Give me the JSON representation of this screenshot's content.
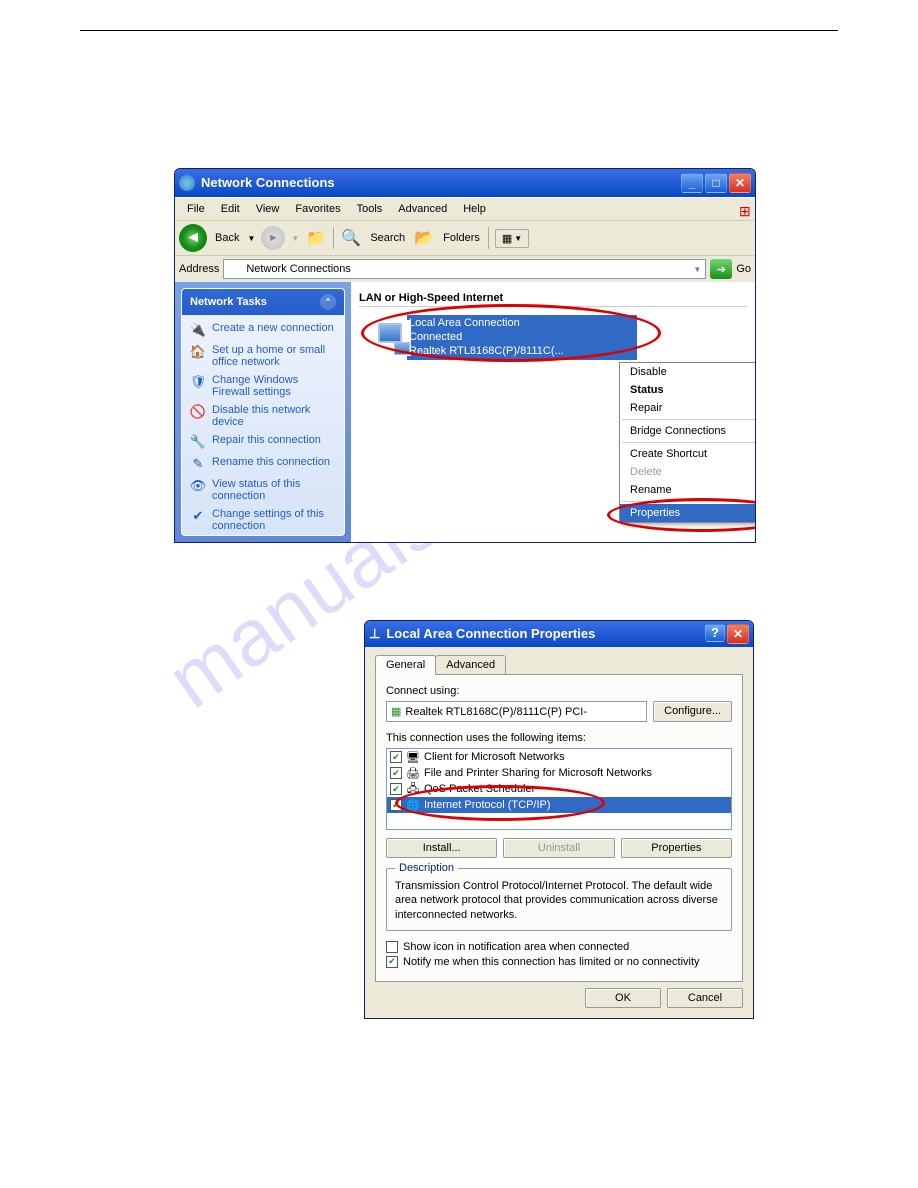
{
  "watermark": "manualshive.com",
  "win1": {
    "title": "Network Connections",
    "menus": [
      "File",
      "Edit",
      "View",
      "Favorites",
      "Tools",
      "Advanced",
      "Help"
    ],
    "toolbar": {
      "back": "Back",
      "search": "Search",
      "folders": "Folders"
    },
    "address": {
      "label": "Address",
      "value": "Network Connections",
      "go": "Go"
    },
    "tasks": {
      "header": "Network Tasks",
      "items": [
        {
          "icon": "🔌",
          "label": "Create a new connection"
        },
        {
          "icon": "🏠",
          "label": "Set up a home or small office network"
        },
        {
          "icon": "🛡",
          "label": "Change Windows Firewall settings"
        },
        {
          "icon": "🚫",
          "label": "Disable this network device"
        },
        {
          "icon": "🔧",
          "label": "Repair this connection"
        },
        {
          "icon": "✎",
          "label": "Rename this connection"
        },
        {
          "icon": "👁",
          "label": "View status of this connection"
        },
        {
          "icon": "✔",
          "label": "Change settings of this connection"
        }
      ]
    },
    "section": "LAN or High-Speed Internet",
    "connection": {
      "name": "Local Area Connection",
      "status": "Connected",
      "adapter": "Realtek RTL8168C(P)/8111C(..."
    },
    "ctx": {
      "disable": "Disable",
      "status": "Status",
      "repair": "Repair",
      "bridge": "Bridge Connections",
      "shortcut": "Create Shortcut",
      "delete": "Delete",
      "rename": "Rename",
      "properties": "Properties"
    }
  },
  "win2": {
    "title": "Local Area Connection Properties",
    "tabs": [
      "General",
      "Advanced"
    ],
    "connect_using": "Connect using:",
    "adapter": "Realtek RTL8168C(P)/8111C(P) PCI-",
    "configure": "Configure...",
    "items_label": "This connection uses the following items:",
    "items": [
      {
        "label": "Client for Microsoft Networks",
        "icon": "🖥",
        "checked": true
      },
      {
        "label": "File and Printer Sharing for Microsoft Networks",
        "icon": "🖨",
        "checked": true
      },
      {
        "label": "QoS Packet Scheduler",
        "icon": "🖧",
        "checked": true
      },
      {
        "label": "Internet Protocol (TCP/IP)",
        "icon": "🌐",
        "checked": true,
        "selected": true
      }
    ],
    "buttons": {
      "install": "Install...",
      "uninstall": "Uninstall",
      "properties": "Properties"
    },
    "desc": {
      "label": "Description",
      "text": "Transmission Control Protocol/Internet Protocol. The default wide area network protocol that provides communication across diverse interconnected networks."
    },
    "check1": "Show icon in notification area when connected",
    "check2": "Notify me when this connection has limited or no connectivity",
    "ok": "OK",
    "cancel": "Cancel"
  }
}
